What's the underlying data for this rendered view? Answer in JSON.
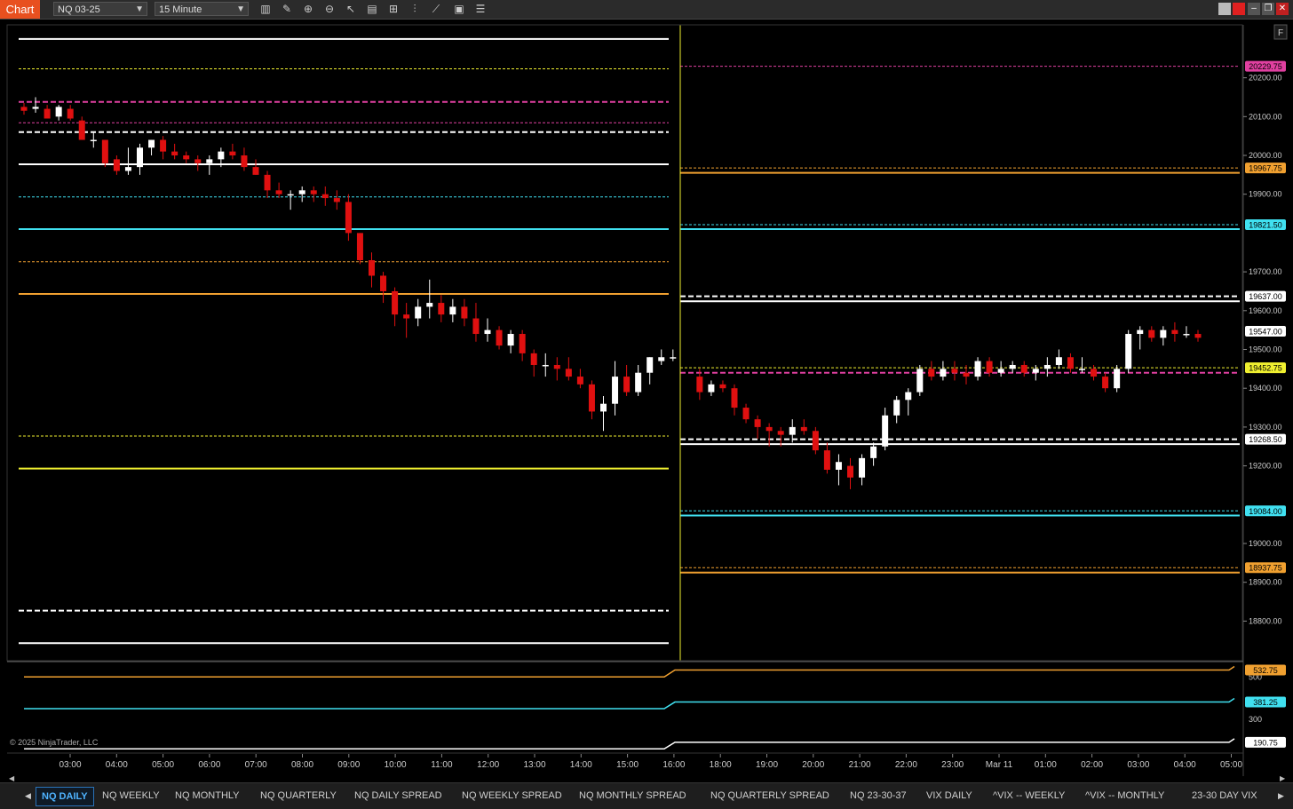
{
  "toolbar": {
    "title": "Chart",
    "instrument": "NQ 03-25",
    "interval": "15 Minute",
    "corner_button": "F",
    "icons": [
      "bars-style-icon",
      "draw-pencil-icon",
      "zoom-in-icon",
      "zoom-out-icon",
      "pointer-icon",
      "properties-icon",
      "template-icon",
      "indicators-icon",
      "strategies-icon",
      "data-box-icon",
      "chart-trader-icon"
    ]
  },
  "copyright": "© 2025 NinjaTrader, LLC",
  "price_axis": {
    "ticks": [
      "20200.00",
      "20100.00",
      "20000.00",
      "19900.00",
      "19700.00",
      "19600.00",
      "19500.00",
      "19400.00",
      "19300.00",
      "19200.00",
      "19000.00",
      "18900.00",
      "18800.00"
    ],
    "labels": [
      {
        "text": "20229.75",
        "color": "#e040a0"
      },
      {
        "text": "19967.75",
        "color": "#f0a030"
      },
      {
        "text": "19821.50",
        "color": "#40e0f0"
      },
      {
        "text": "19637.00",
        "color": "#ffffff"
      },
      {
        "text": "19547.00",
        "color": "#ffffff"
      },
      {
        "text": "19452.75",
        "color": "#f0f030"
      },
      {
        "text": "19268.50",
        "color": "#ffffff"
      },
      {
        "text": "19084.00",
        "color": "#40e0f0"
      },
      {
        "text": "18937.75",
        "color": "#f0a030"
      }
    ]
  },
  "lower_panel": {
    "ticks": [
      "500",
      "300"
    ],
    "labels": [
      {
        "text": "532.75",
        "color": "#f0a030"
      },
      {
        "text": "381.25",
        "color": "#40e0f0"
      },
      {
        "text": "190.75",
        "color": "#ffffff"
      }
    ]
  },
  "time_axis": [
    "03:00",
    "04:00",
    "05:00",
    "06:00",
    "07:00",
    "08:00",
    "09:00",
    "10:00",
    "11:00",
    "12:00",
    "13:00",
    "14:00",
    "15:00",
    "16:00",
    "18:00",
    "19:00",
    "20:00",
    "21:00",
    "22:00",
    "23:00",
    "Mar 11",
    "01:00",
    "02:00",
    "03:00",
    "04:00",
    "05:00"
  ],
  "tabs": [
    "NQ DAILY",
    "NQ WEEKLY",
    "NQ MONTHLY",
    "NQ QUARTERLY",
    "NQ DAILY SPREAD",
    "NQ WEEKLY SPREAD",
    "NQ MONTHLY SPREAD",
    "NQ QUARTERLY SPREAD",
    "NQ 23-30-37",
    "VIX DAILY",
    "^VIX -- WEEKLY",
    "^VIX -- MONTHLY",
    "23-30 DAY VIX"
  ],
  "active_tab": "NQ DAILY",
  "colors": {
    "up": "#ffffff",
    "down": "#e01010",
    "orange": "#f0a030",
    "cyan": "#40e0f0",
    "yellow": "#f0f030",
    "magenta": "#e040a0",
    "white": "#ffffff"
  },
  "chart_data": {
    "type": "candlestick",
    "instrument": "NQ 03-25",
    "interval": "15 Minute",
    "y_range": [
      18700,
      20300
    ],
    "candles": [
      [
        20125,
        20135,
        20105,
        20115
      ],
      [
        20120,
        20150,
        20110,
        20125
      ],
      [
        20120,
        20130,
        20095,
        20095
      ],
      [
        20100,
        20130,
        20090,
        20125
      ],
      [
        20120,
        20130,
        20090,
        20095
      ],
      [
        20090,
        20100,
        20040,
        20040
      ],
      [
        20040,
        20060,
        20020,
        20040
      ],
      [
        20040,
        20040,
        19970,
        19980
      ],
      [
        19990,
        20000,
        19950,
        19960
      ],
      [
        19960,
        20020,
        19950,
        19970
      ],
      [
        19970,
        20030,
        19950,
        20020
      ],
      [
        20020,
        20040,
        20000,
        20040
      ],
      [
        20040,
        20050,
        19990,
        20010
      ],
      [
        20010,
        20030,
        19990,
        20000
      ],
      [
        20000,
        20010,
        19980,
        19990
      ],
      [
        19990,
        20000,
        19960,
        19980
      ],
      [
        19980,
        20000,
        19950,
        19990
      ],
      [
        19990,
        20020,
        19970,
        20010
      ],
      [
        20010,
        20030,
        19990,
        20000
      ],
      [
        20000,
        20020,
        19960,
        19970
      ],
      [
        19970,
        19990,
        19950,
        19950
      ],
      [
        19950,
        19960,
        19890,
        19910
      ],
      [
        19910,
        19930,
        19890,
        19900
      ],
      [
        19900,
        19910,
        19860,
        19900
      ],
      [
        19900,
        19920,
        19880,
        19910
      ],
      [
        19910,
        19920,
        19880,
        19900
      ],
      [
        19900,
        19920,
        19870,
        19890
      ],
      [
        19890,
        19910,
        19860,
        19880
      ],
      [
        19880,
        19900,
        19780,
        19800
      ],
      [
        19800,
        19800,
        19720,
        19730
      ],
      [
        19730,
        19750,
        19660,
        19690
      ],
      [
        19690,
        19700,
        19620,
        19650
      ],
      [
        19650,
        19660,
        19560,
        19590
      ],
      [
        19590,
        19620,
        19530,
        19580
      ],
      [
        19580,
        19630,
        19560,
        19610
      ],
      [
        19610,
        19680,
        19580,
        19620
      ],
      [
        19620,
        19640,
        19570,
        19590
      ],
      [
        19590,
        19630,
        19570,
        19610
      ],
      [
        19610,
        19630,
        19560,
        19580
      ],
      [
        19580,
        19620,
        19520,
        19540
      ],
      [
        19540,
        19580,
        19520,
        19550
      ],
      [
        19550,
        19560,
        19500,
        19510
      ],
      [
        19510,
        19550,
        19490,
        19540
      ],
      [
        19540,
        19550,
        19470,
        19490
      ],
      [
        19490,
        19500,
        19430,
        19460
      ],
      [
        19460,
        19490,
        19430,
        19460
      ],
      [
        19460,
        19480,
        19420,
        19450
      ],
      [
        19450,
        19480,
        19420,
        19430
      ],
      [
        19430,
        19450,
        19400,
        19410
      ],
      [
        19410,
        19420,
        19320,
        19340
      ],
      [
        19340,
        19380,
        19290,
        19360
      ],
      [
        19360,
        19470,
        19330,
        19430
      ],
      [
        19430,
        19460,
        19380,
        19390
      ],
      [
        19390,
        19460,
        19380,
        19440
      ],
      [
        19440,
        19480,
        19410,
        19480
      ],
      [
        19470,
        19500,
        19460,
        19480
      ],
      [
        19480,
        19500,
        19470,
        19480
      ],
      [
        19430,
        19450,
        19370,
        19390
      ],
      [
        19390,
        19420,
        19380,
        19410
      ],
      [
        19410,
        19420,
        19390,
        19400
      ],
      [
        19400,
        19410,
        19330,
        19350
      ],
      [
        19350,
        19360,
        19310,
        19320
      ],
      [
        19320,
        19330,
        19270,
        19300
      ],
      [
        19300,
        19310,
        19250,
        19290
      ],
      [
        19290,
        19300,
        19250,
        19280
      ],
      [
        19280,
        19320,
        19260,
        19300
      ],
      [
        19300,
        19320,
        19280,
        19290
      ],
      [
        19290,
        19300,
        19230,
        19240
      ],
      [
        19240,
        19260,
        19180,
        19190
      ],
      [
        19190,
        19230,
        19150,
        19210
      ],
      [
        19200,
        19220,
        19140,
        19170
      ],
      [
        19170,
        19230,
        19150,
        19220
      ],
      [
        19220,
        19260,
        19200,
        19250
      ],
      [
        19250,
        19350,
        19240,
        19330
      ],
      [
        19330,
        19380,
        19310,
        19370
      ],
      [
        19370,
        19400,
        19330,
        19390
      ],
      [
        19390,
        19460,
        19380,
        19450
      ],
      [
        19450,
        19470,
        19420,
        19430
      ],
      [
        19430,
        19470,
        19420,
        19450
      ],
      [
        19450,
        19470,
        19420,
        19440
      ],
      [
        19440,
        19460,
        19410,
        19430
      ],
      [
        19430,
        19480,
        19420,
        19470
      ],
      [
        19470,
        19480,
        19430,
        19440
      ],
      [
        19440,
        19470,
        19430,
        19450
      ],
      [
        19450,
        19470,
        19440,
        19460
      ],
      [
        19460,
        19470,
        19430,
        19440
      ],
      [
        19440,
        19460,
        19420,
        19450
      ],
      [
        19450,
        19480,
        19430,
        19460
      ],
      [
        19460,
        19500,
        19450,
        19480
      ],
      [
        19480,
        19490,
        19440,
        19450
      ],
      [
        19450,
        19480,
        19440,
        19450
      ],
      [
        19450,
        19460,
        19420,
        19430
      ],
      [
        19430,
        19440,
        19390,
        19400
      ],
      [
        19400,
        19460,
        19390,
        19450
      ],
      [
        19450,
        19550,
        19440,
        19540
      ],
      [
        19540,
        19560,
        19500,
        19550
      ],
      [
        19550,
        19560,
        19520,
        19530
      ],
      [
        19530,
        19560,
        19510,
        19550
      ],
      [
        19550,
        19570,
        19520,
        19540
      ],
      [
        19540,
        19560,
        19530,
        19540
      ],
      [
        19540,
        19550,
        19520,
        19530
      ]
    ],
    "levels_left": [
      {
        "price": 20300,
        "color": "white",
        "style": "solid"
      },
      {
        "price": 20223,
        "color": "yellow",
        "style": "dotted"
      },
      {
        "price": 20138,
        "color": "magenta",
        "style": "dashed"
      },
      {
        "price": 20084,
        "color": "magenta",
        "style": "dotted"
      },
      {
        "price": 20060,
        "color": "white",
        "style": "dashed"
      },
      {
        "price": 19977,
        "color": "white",
        "style": "solid"
      },
      {
        "price": 19893,
        "color": "cyan",
        "style": "dotted"
      },
      {
        "price": 19810,
        "color": "cyan",
        "style": "solid"
      },
      {
        "price": 19726,
        "color": "orange",
        "style": "dotted"
      },
      {
        "price": 19643,
        "color": "orange",
        "style": "solid"
      },
      {
        "price": 19277,
        "color": "yellow",
        "style": "dotted"
      },
      {
        "price": 19193,
        "color": "yellow",
        "style": "solid"
      },
      {
        "price": 18827,
        "color": "white",
        "style": "dashed"
      },
      {
        "price": 18743,
        "color": "white",
        "style": "solid"
      }
    ],
    "levels_right": [
      {
        "price": 20229.75,
        "color": "magenta",
        "style": "dotted"
      },
      {
        "price": 19967.75,
        "color": "orange",
        "style": "dotted"
      },
      {
        "price": 19955,
        "color": "orange",
        "style": "solid"
      },
      {
        "price": 19821.5,
        "color": "cyan",
        "style": "dotted"
      },
      {
        "price": 19810,
        "color": "cyan",
        "style": "solid"
      },
      {
        "price": 19637,
        "color": "white",
        "style": "dashed"
      },
      {
        "price": 19624,
        "color": "white",
        "style": "solid"
      },
      {
        "price": 19452.75,
        "color": "yellow",
        "style": "dotted"
      },
      {
        "price": 19440,
        "color": "magenta",
        "style": "dashed"
      },
      {
        "price": 19268.5,
        "color": "white",
        "style": "dashed"
      },
      {
        "price": 19256,
        "color": "white",
        "style": "solid"
      },
      {
        "price": 19084,
        "color": "cyan",
        "style": "dotted"
      },
      {
        "price": 19072,
        "color": "cyan",
        "style": "solid"
      },
      {
        "price": 18937.75,
        "color": "orange",
        "style": "dotted"
      },
      {
        "price": 18925,
        "color": "orange",
        "style": "solid"
      }
    ],
    "lower_series": [
      {
        "color": "orange",
        "before": 500,
        "after": 532.75
      },
      {
        "color": "cyan",
        "before": 350,
        "after": 381.25
      },
      {
        "color": "white",
        "before": 160,
        "after": 190.75
      }
    ],
    "lower_range": [
      140,
      560
    ]
  }
}
